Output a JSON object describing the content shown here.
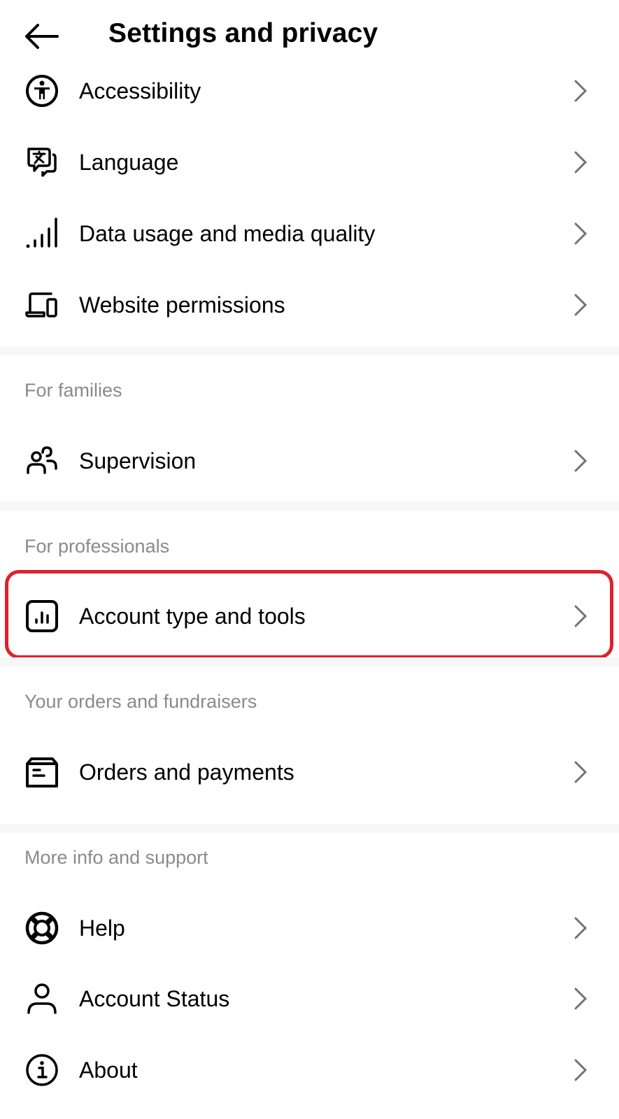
{
  "header": {
    "title": "Settings and privacy",
    "back_icon": "arrow-left-icon"
  },
  "groups": [
    {
      "header": null,
      "items": [
        {
          "label": "Accessibility",
          "icon": "accessibility-icon"
        },
        {
          "label": "Language",
          "icon": "language-icon"
        },
        {
          "label": "Data usage and media quality",
          "icon": "signal-bars-icon"
        },
        {
          "label": "Website permissions",
          "icon": "devices-icon"
        }
      ]
    },
    {
      "header": "For families",
      "items": [
        {
          "label": "Supervision",
          "icon": "supervision-icon"
        }
      ]
    },
    {
      "header": "For professionals",
      "items": [
        {
          "label": "Account type and tools",
          "icon": "insights-chart-icon",
          "highlighted": true
        }
      ]
    },
    {
      "header": "Your orders and fundraisers",
      "items": [
        {
          "label": "Orders and payments",
          "icon": "orders-box-icon"
        }
      ]
    },
    {
      "header": "More info and support",
      "items": [
        {
          "label": "Help",
          "icon": "lifebuoy-icon"
        },
        {
          "label": "Account Status",
          "icon": "person-icon"
        },
        {
          "label": "About",
          "icon": "info-icon"
        }
      ]
    }
  ],
  "colors": {
    "highlight_border": "#e0202a",
    "section_header": "#8a8a8a",
    "chevron": "#737373",
    "separator": "#f7f7f7"
  }
}
